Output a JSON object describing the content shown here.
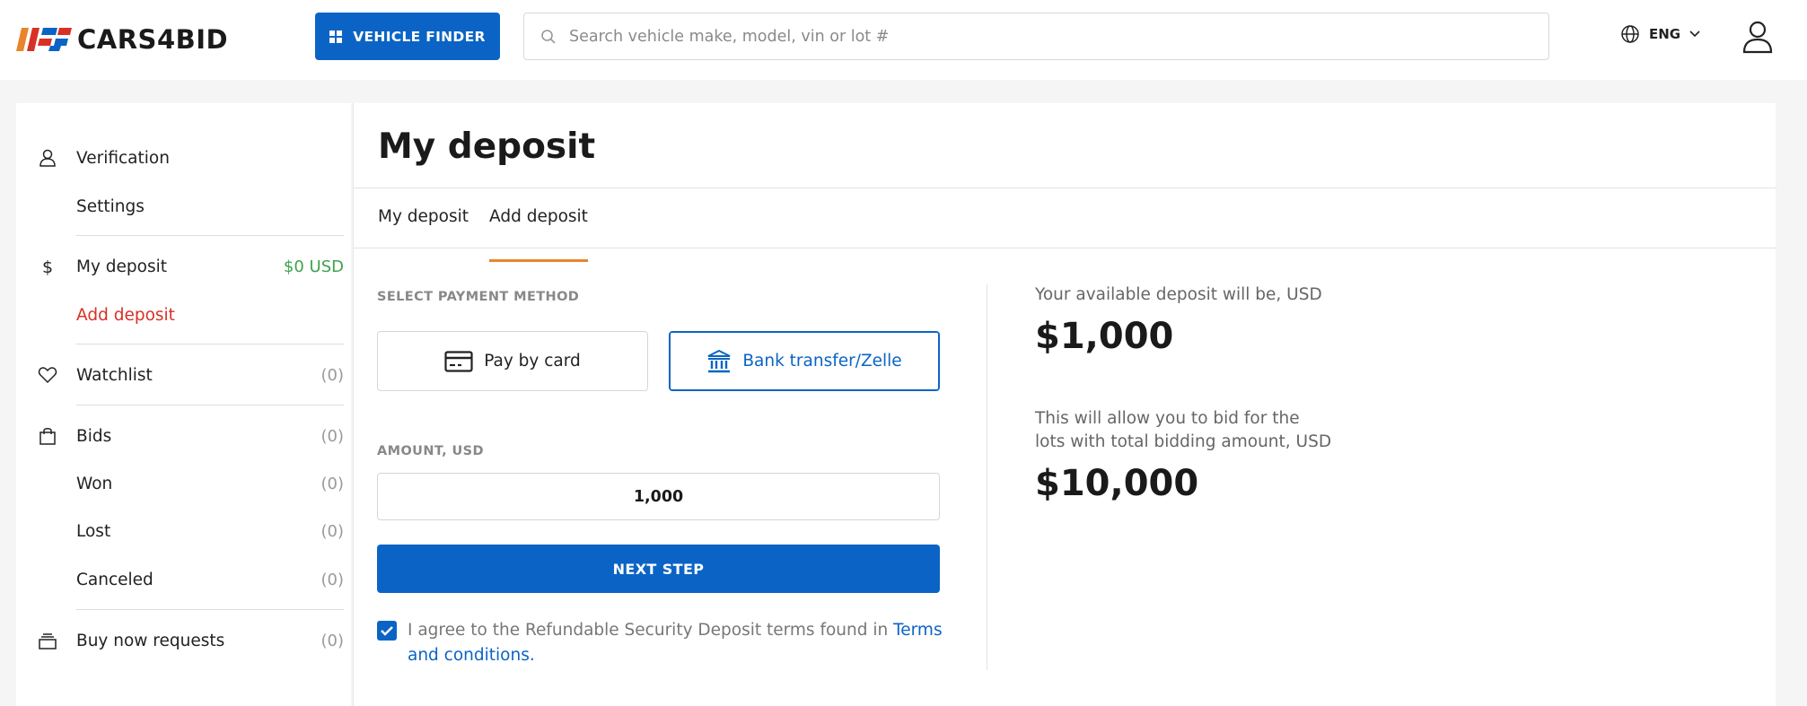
{
  "header": {
    "logo_text": "CARS4BID",
    "vehicle_finder_label": "VEHICLE FINDER",
    "search_placeholder": "Search vehicle make, model, vin or lot #",
    "language": "ENG"
  },
  "sidebar": {
    "verification": "Verification",
    "settings": "Settings",
    "my_deposit": "My deposit",
    "my_deposit_amount": "$0 USD",
    "add_deposit": "Add deposit",
    "watchlist": "Watchlist",
    "watchlist_count": "(0)",
    "bids": "Bids",
    "bids_count": "(0)",
    "won": "Won",
    "won_count": "(0)",
    "lost": "Lost",
    "lost_count": "(0)",
    "canceled": "Canceled",
    "canceled_count": "(0)",
    "buy_now": "Buy now requests",
    "buy_now_count": "(0)"
  },
  "main": {
    "title": "My deposit",
    "tabs": [
      "My deposit",
      "Add deposit"
    ],
    "payment_label": "SELECT PAYMENT METHOD",
    "pay_by_card": "Pay by card",
    "bank_transfer": "Bank transfer/Zelle",
    "amount_label": "AMOUNT, USD",
    "amount_value": "1,000",
    "next_step": "NEXT STEP",
    "agree_text": "I agree to the Refundable Security Deposit terms found in ",
    "terms_link": "Terms and conditions",
    "agree_end": ".",
    "available_label": "Your available deposit will be, USD",
    "available_amount": "$1,000",
    "allow_line1": "This will allow you to bid for the",
    "allow_line2": "lots with total bidding amount, USD",
    "bidding_amount": "$10,000"
  },
  "colors": {
    "brand_blue": "#0b64c5",
    "accent_orange": "#e8852a",
    "active_red": "#d93025",
    "deposit_green": "#3fa34d"
  }
}
